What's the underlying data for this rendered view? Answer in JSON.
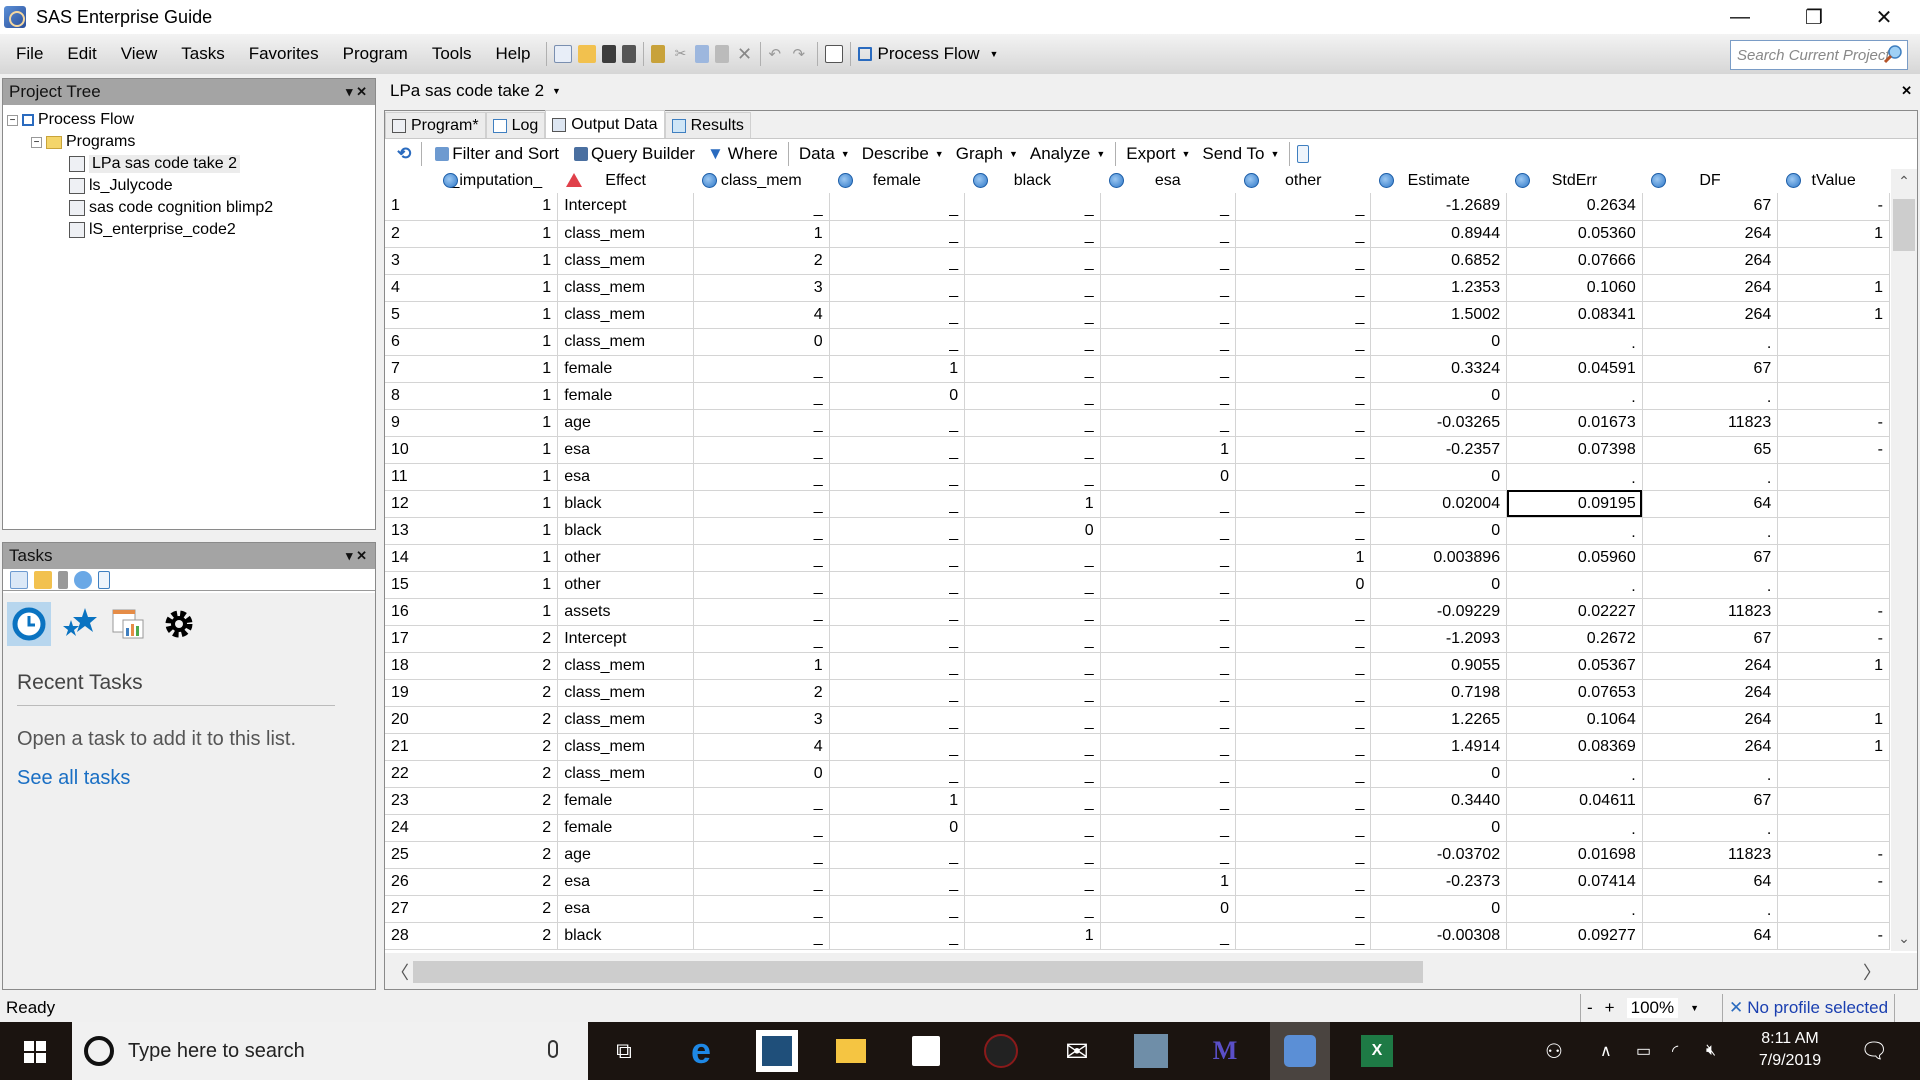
{
  "window": {
    "title": "SAS Enterprise Guide",
    "controls": {
      "minimize": "—",
      "restore": "❐",
      "close": "✕"
    }
  },
  "menu": [
    "File",
    "Edit",
    "View",
    "Tasks",
    "Favorites",
    "Program",
    "Tools",
    "Help"
  ],
  "toolbar": {
    "process_flow_label": "Process Flow",
    "search_placeholder": "Search Current Project"
  },
  "project_tree": {
    "title": "Project Tree",
    "items": [
      {
        "label": "Process Flow",
        "level": 0,
        "icon": "process-flow-icon"
      },
      {
        "label": "Programs",
        "level": 1,
        "icon": "folder-icon"
      },
      {
        "label": "LPa sas code take 2",
        "level": 2,
        "icon": "sas-program-icon",
        "selected": true
      },
      {
        "label": "ls_Julycode",
        "level": 2,
        "icon": "sas-program-icon"
      },
      {
        "label": "sas code cognition blimp2",
        "level": 2,
        "icon": "sas-program-icon"
      },
      {
        "label": "lS_enterprise_code2",
        "level": 2,
        "icon": "sas-program-icon"
      }
    ]
  },
  "tasks_panel": {
    "title": "Tasks",
    "recent_heading": "Recent Tasks",
    "empty_message": "Open a task to add it to this list.",
    "see_all_link": "See all tasks"
  },
  "document": {
    "title": "LPa sas code take 2",
    "tabs": [
      {
        "label": "Program*",
        "icon": "program-icon"
      },
      {
        "label": "Log",
        "icon": "log-icon"
      },
      {
        "label": "Output Data",
        "icon": "output-data-icon",
        "active": true
      },
      {
        "label": "Results",
        "icon": "results-icon"
      }
    ],
    "data_toolbar": {
      "filter_sort": "Filter and Sort",
      "query_builder": "Query Builder",
      "where": "Where",
      "menus": [
        "Data",
        "Describe",
        "Graph",
        "Analyze"
      ],
      "menus2": [
        "Export",
        "Send To"
      ]
    }
  },
  "table": {
    "columns": [
      {
        "name": "_imputation_",
        "type": "numeric"
      },
      {
        "name": "Effect",
        "type": "character"
      },
      {
        "name": "class_mem",
        "type": "numeric"
      },
      {
        "name": "female",
        "type": "numeric"
      },
      {
        "name": "black",
        "type": "numeric"
      },
      {
        "name": "esa",
        "type": "numeric"
      },
      {
        "name": "other",
        "type": "numeric"
      },
      {
        "name": "Estimate",
        "type": "numeric"
      },
      {
        "name": "StdErr",
        "type": "numeric"
      },
      {
        "name": "DF",
        "type": "numeric"
      },
      {
        "name": "tValue",
        "type": "numeric"
      }
    ],
    "selected_cell": {
      "row": 12,
      "column": "StdErr"
    },
    "rows": [
      [
        "1",
        "1",
        "Intercept",
        "_",
        "_",
        "_",
        "_",
        "_",
        "-1.2689",
        "0.2634",
        "67",
        "-"
      ],
      [
        "2",
        "1",
        "class_mem",
        "1",
        "_",
        "_",
        "_",
        "_",
        "0.8944",
        "0.05360",
        "264",
        "1"
      ],
      [
        "3",
        "1",
        "class_mem",
        "2",
        "_",
        "_",
        "_",
        "_",
        "0.6852",
        "0.07666",
        "264",
        ""
      ],
      [
        "4",
        "1",
        "class_mem",
        "3",
        "_",
        "_",
        "_",
        "_",
        "1.2353",
        "0.1060",
        "264",
        "1"
      ],
      [
        "5",
        "1",
        "class_mem",
        "4",
        "_",
        "_",
        "_",
        "_",
        "1.5002",
        "0.08341",
        "264",
        "1"
      ],
      [
        "6",
        "1",
        "class_mem",
        "0",
        "_",
        "_",
        "_",
        "_",
        "0",
        ".",
        ".",
        ""
      ],
      [
        "7",
        "1",
        "female",
        "_",
        "1",
        "_",
        "_",
        "_",
        "0.3324",
        "0.04591",
        "67",
        ""
      ],
      [
        "8",
        "1",
        "female",
        "_",
        "0",
        "_",
        "_",
        "_",
        "0",
        ".",
        ".",
        ""
      ],
      [
        "9",
        "1",
        "age",
        "_",
        "_",
        "_",
        "_",
        "_",
        "-0.03265",
        "0.01673",
        "11823",
        "-"
      ],
      [
        "10",
        "1",
        "esa",
        "_",
        "_",
        "_",
        "1",
        "_",
        "-0.2357",
        "0.07398",
        "65",
        "-"
      ],
      [
        "11",
        "1",
        "esa",
        "_",
        "_",
        "_",
        "0",
        "_",
        "0",
        ".",
        ".",
        ""
      ],
      [
        "12",
        "1",
        "black",
        "_",
        "_",
        "1",
        "_",
        "_",
        "0.02004",
        "0.09195",
        "64",
        ""
      ],
      [
        "13",
        "1",
        "black",
        "_",
        "_",
        "0",
        "_",
        "_",
        "0",
        ".",
        ".",
        ""
      ],
      [
        "14",
        "1",
        "other",
        "_",
        "_",
        "_",
        "_",
        "1",
        "0.003896",
        "0.05960",
        "67",
        ""
      ],
      [
        "15",
        "1",
        "other",
        "_",
        "_",
        "_",
        "_",
        "0",
        "0",
        ".",
        ".",
        ""
      ],
      [
        "16",
        "1",
        "assets",
        "_",
        "_",
        "_",
        "_",
        "_",
        "-0.09229",
        "0.02227",
        "11823",
        "-"
      ],
      [
        "17",
        "2",
        "Intercept",
        "_",
        "_",
        "_",
        "_",
        "_",
        "-1.2093",
        "0.2672",
        "67",
        "-"
      ],
      [
        "18",
        "2",
        "class_mem",
        "1",
        "_",
        "_",
        "_",
        "_",
        "0.9055",
        "0.05367",
        "264",
        "1"
      ],
      [
        "19",
        "2",
        "class_mem",
        "2",
        "_",
        "_",
        "_",
        "_",
        "0.7198",
        "0.07653",
        "264",
        ""
      ],
      [
        "20",
        "2",
        "class_mem",
        "3",
        "_",
        "_",
        "_",
        "_",
        "1.2265",
        "0.1064",
        "264",
        "1"
      ],
      [
        "21",
        "2",
        "class_mem",
        "4",
        "_",
        "_",
        "_",
        "_",
        "1.4914",
        "0.08369",
        "264",
        "1"
      ],
      [
        "22",
        "2",
        "class_mem",
        "0",
        "_",
        "_",
        "_",
        "_",
        "0",
        ".",
        ".",
        ""
      ],
      [
        "23",
        "2",
        "female",
        "_",
        "1",
        "_",
        "_",
        "_",
        "0.3440",
        "0.04611",
        "67",
        ""
      ],
      [
        "24",
        "2",
        "female",
        "_",
        "0",
        "_",
        "_",
        "_",
        "0",
        ".",
        ".",
        ""
      ],
      [
        "25",
        "2",
        "age",
        "_",
        "_",
        "_",
        "_",
        "_",
        "-0.03702",
        "0.01698",
        "11823",
        "-"
      ],
      [
        "26",
        "2",
        "esa",
        "_",
        "_",
        "_",
        "1",
        "_",
        "-0.2373",
        "0.07414",
        "64",
        "-"
      ],
      [
        "27",
        "2",
        "esa",
        "_",
        "_",
        "_",
        "0",
        "_",
        "0",
        ".",
        ".",
        ""
      ],
      [
        "28",
        "2",
        "black",
        "_",
        "_",
        "1",
        "_",
        "_",
        "-0.00308",
        "0.09277",
        "64",
        "-"
      ]
    ]
  },
  "statusbar": {
    "status": "Ready",
    "zoom_minus": "-",
    "zoom_plus": "+",
    "zoom": "100%",
    "profile": "No profile selected"
  },
  "taskbar": {
    "search_placeholder": "Type here to search",
    "time": "8:11 AM",
    "date": "7/9/2019"
  }
}
